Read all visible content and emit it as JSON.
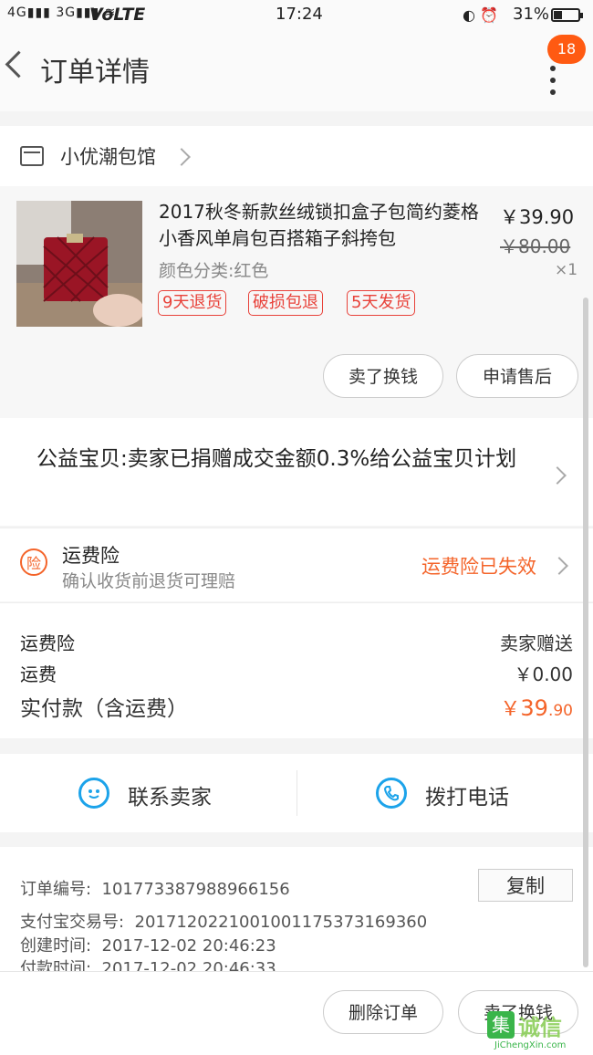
{
  "status_bar": {
    "signal": "4G",
    "signal2": "3G",
    "network": "VoLTE",
    "time": "17:24",
    "battery": "31%"
  },
  "header": {
    "title": "订单详情",
    "notification_count": "18"
  },
  "shop": {
    "name": "小优潮包馆"
  },
  "item": {
    "title": "2017秋冬新款丝绒锁扣盒子包简约菱格小香风单肩包百搭箱子斜挎包",
    "price": "￥39.90",
    "original_price": "￥80.00",
    "quantity": "×1",
    "sku": "颜色分类:红色",
    "tags": [
      "9天退货",
      "破损包退",
      "5天发货"
    ],
    "actions": [
      "卖了换钱",
      "申请售后"
    ]
  },
  "charity": {
    "text": "公益宝贝:卖家已捐赠成交金额0.3%给公益宝贝计划"
  },
  "insurance": {
    "icon_label": "险",
    "title": "运费险",
    "subtitle": "确认收货前退货可理赔",
    "status": "运费险已失效"
  },
  "fees": {
    "rows": [
      {
        "label": "运费险",
        "value": "卖家赠送"
      },
      {
        "label": "运费",
        "value": "￥0.00"
      }
    ],
    "paid_label": "实付款（含运费）",
    "paid_currency": "￥",
    "paid_int": "39",
    "paid_dec": ".90"
  },
  "contact": {
    "seller": "联系卖家",
    "call": "拨打电话"
  },
  "order_info": {
    "order_no_label": "订单编号:",
    "order_no": "101773387988966156",
    "copy_label": "复制",
    "alipay_label": "支付宝交易号:",
    "alipay_no": "2017120221001001175373169360",
    "created_label": "创建时间:",
    "created": "2017-12-02 20:46:23",
    "paid_label": "付款时间:",
    "paid": "2017-12-02 20:46:33"
  },
  "footer": {
    "delete": "删除订单",
    "sell": "卖了换钱"
  },
  "watermark": {
    "glyph": "集",
    "text": "诚信",
    "sub": "JiChengXin.com"
  },
  "colors": {
    "accent": "#f4642a",
    "tag_red": "#e8423a",
    "contact_blue": "#1ca3ea"
  }
}
